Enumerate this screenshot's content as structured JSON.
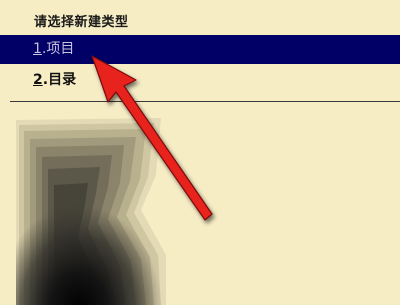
{
  "dialog": {
    "title": "请选择新建类型"
  },
  "menu": {
    "items": [
      {
        "accel": "1",
        "rest": ".项目",
        "selected": true
      },
      {
        "accel": "2",
        "rest": ".目录",
        "selected": false
      }
    ]
  },
  "colors": {
    "background": "#F6EDC5",
    "selection": "#000066",
    "annotation_arrow": "#E8201C"
  }
}
